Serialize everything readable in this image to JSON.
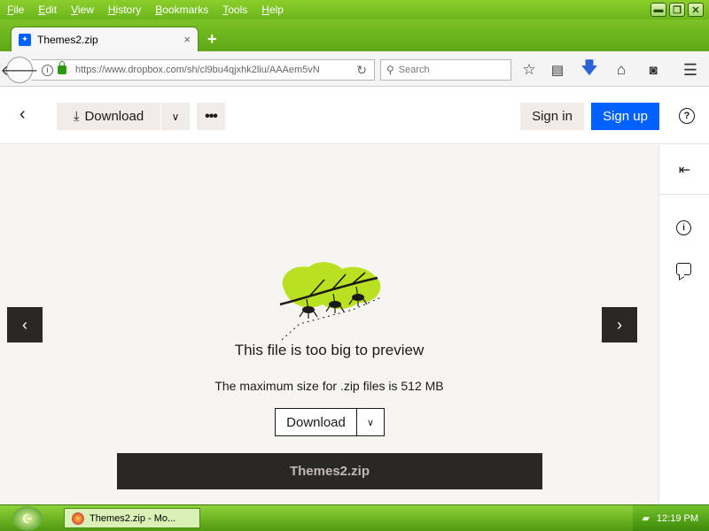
{
  "menubar": {
    "items": [
      "File",
      "Edit",
      "View",
      "History",
      "Bookmarks",
      "Tools",
      "Help"
    ]
  },
  "window_controls": {
    "minimize": "▬",
    "restore": "❐",
    "close": "✕"
  },
  "tab": {
    "title": "Themes2.zip",
    "close": "×",
    "favicon": "dropbox-icon"
  },
  "newtab": "+",
  "toolbar": {
    "url": "https://www.dropbox.com/sh/cl9bu4qjxhk2liu/AAAem5vN",
    "search_placeholder": "Search",
    "icons": [
      "star-icon",
      "reading-list-icon",
      "download-arrow-icon",
      "home-icon",
      "pocket-icon",
      "menu-icon"
    ]
  },
  "header": {
    "download_label": "Download",
    "signin_label": "Sign in",
    "signup_label": "Sign up",
    "help_label": "?"
  },
  "preview": {
    "too_big": "This file is too big to preview",
    "max_size": "The maximum size for .zip files is 512 MB",
    "download_label": "Download",
    "file_name": "Themes2.zip"
  },
  "taskbar": {
    "task_label": "Themes2.zip - Mo...",
    "clock": "12:19 PM"
  },
  "colors": {
    "accent_blue": "#0061fe",
    "chrome_green": "#6bb51c",
    "leaf_green": "#b9e021",
    "dark": "#2a2727"
  }
}
